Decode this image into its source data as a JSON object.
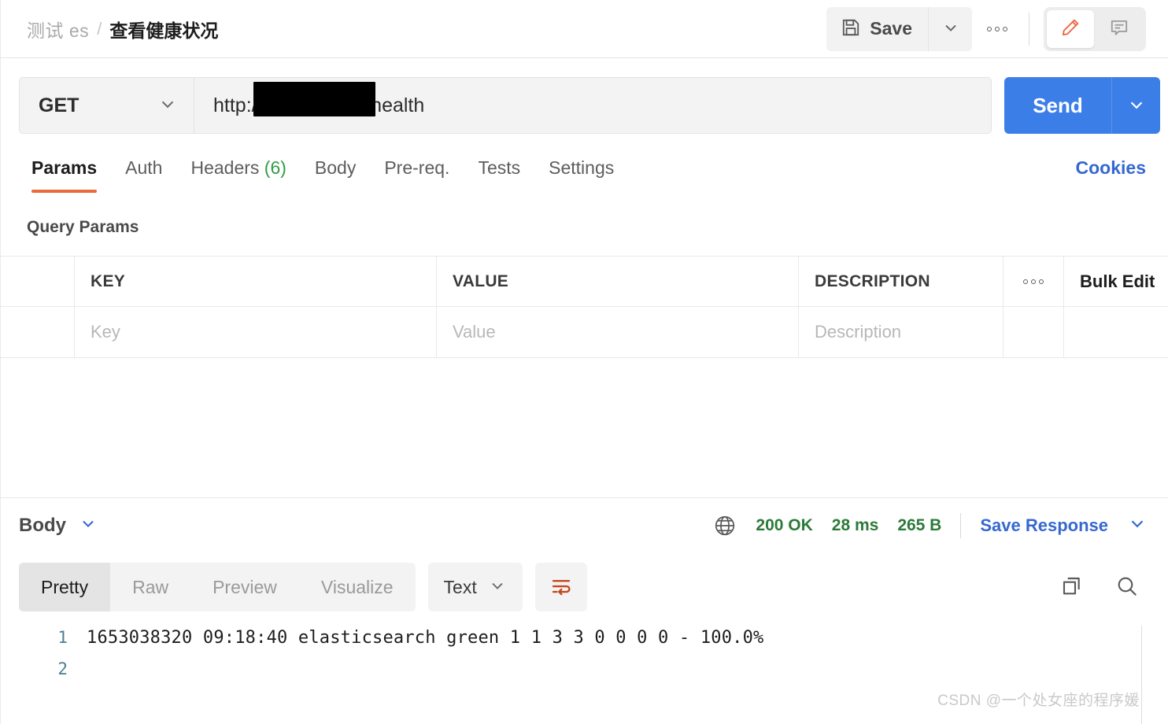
{
  "header": {
    "breadcrumb": {
      "collection": "测试 es",
      "separator": "/",
      "title": "查看健康状况"
    },
    "save_label": "Save",
    "save_icon": "floppy-disk-icon",
    "save_caret_icon": "chevron-down-icon",
    "more_icon": "ellipsis-icon",
    "edit_icon": "pencil-icon",
    "comment_icon": "comment-icon",
    "accent_color": "#eb6a3a"
  },
  "request": {
    "method": "GET",
    "method_caret_icon": "chevron-down-icon",
    "url_prefix": "http://1",
    "url_suffix": ":9200/_cat/health",
    "url_redacted": true,
    "send_label": "Send",
    "send_caret_icon": "chevron-down-icon",
    "send_color": "#3c7ee8"
  },
  "tabs": [
    {
      "label": "Params",
      "active": true,
      "count": ""
    },
    {
      "label": "Auth",
      "active": false,
      "count": ""
    },
    {
      "label": "Headers",
      "active": false,
      "count": "(6)"
    },
    {
      "label": "Body",
      "active": false,
      "count": ""
    },
    {
      "label": "Pre-req.",
      "active": false,
      "count": ""
    },
    {
      "label": "Tests",
      "active": false,
      "count": ""
    },
    {
      "label": "Settings",
      "active": false,
      "count": ""
    }
  ],
  "cookies_label": "Cookies",
  "query_params": {
    "section_title": "Query Params",
    "columns": [
      "KEY",
      "VALUE",
      "DESCRIPTION"
    ],
    "more_icon": "ellipsis-icon",
    "bulk_edit_label": "Bulk Edit",
    "empty_row": {
      "key_placeholder": "Key",
      "value_placeholder": "Value",
      "description_placeholder": "Description"
    }
  },
  "response": {
    "body_label": "Body",
    "body_caret_icon": "chevron-down-icon",
    "globe_icon": "globe-icon",
    "status": "200 OK",
    "time": "28 ms",
    "size": "265 B",
    "status_color": "#2c7a39",
    "save_response_label": "Save Response",
    "save_response_caret_icon": "chevron-down-icon",
    "view_tabs": [
      {
        "label": "Pretty",
        "active": true
      },
      {
        "label": "Raw",
        "active": false
      },
      {
        "label": "Preview",
        "active": false
      },
      {
        "label": "Visualize",
        "active": false
      }
    ],
    "format": "Text",
    "format_caret_icon": "chevron-down-icon",
    "wrap_icon": "word-wrap-icon",
    "copy_icon": "copy-icon",
    "search_icon": "search-icon",
    "body_lines": [
      {
        "number": "1",
        "text": "1653038320 09:18:40 elasticsearch green 1 1 3 3 0 0 0 0 - 100.0%"
      },
      {
        "number": "2",
        "text": ""
      }
    ]
  },
  "watermark": "CSDN @一个处女座的程序媛"
}
